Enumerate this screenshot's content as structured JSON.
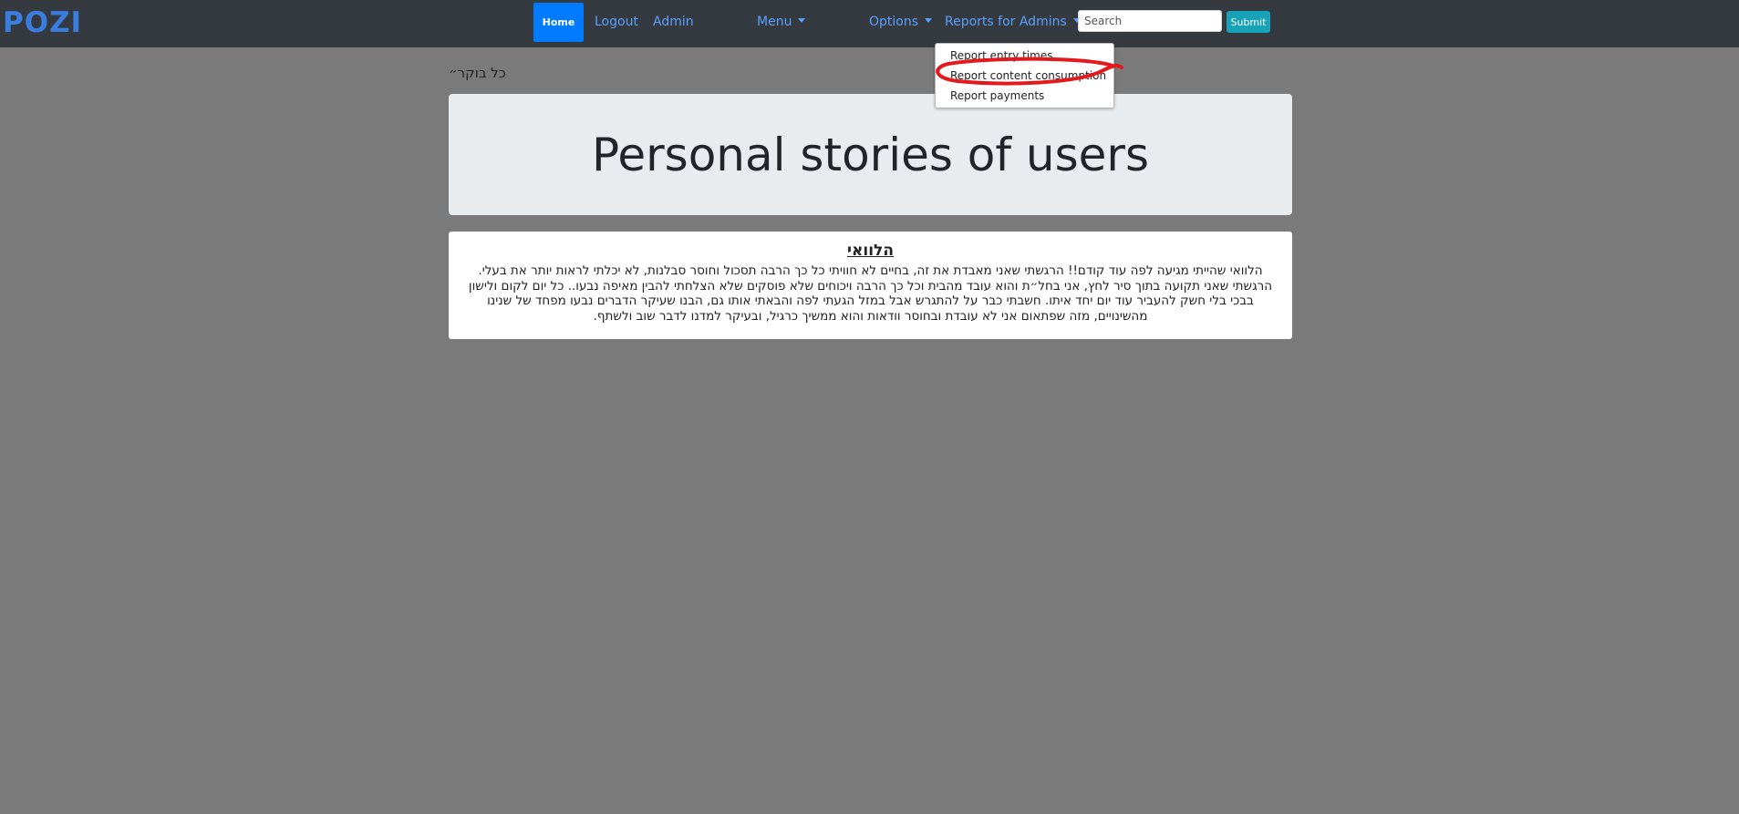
{
  "nav": {
    "brand": "POZI",
    "home": "Home",
    "logout": "Logout",
    "admin": "Admin",
    "menu": "Menu",
    "options": "Options",
    "reports_for_admins": "Reports for Admins",
    "search_placeholder": "Search",
    "submit": "Submit"
  },
  "reports_dropdown": {
    "items": [
      "Report entry times",
      "Report content consumption",
      "Report payments"
    ]
  },
  "quote": "כל בוקר״",
  "jumbotron": {
    "title": "Personal stories of users"
  },
  "story": {
    "title": "הלוואי",
    "text": "הלוואי שהייתי מגיעה לפה עוד קודם!! הרגשתי שאני מאבדת את זה, בחיים לא חוויתי כל כך הרבה תסכול וחוסר סבלנות, לא יכלתי לראות יותר את בעלי. הרגשתי שאני תקועה בתוך סיר לחץ, אני בחל״ת והוא עובד מהבית וכל כך הרבה ויכוחים שלא פוסקים שלא הצלחתי להבין מאיפה נבעו.. כל יום לקום ולישון בבכי בלי חשק להעביר עוד יום יחד איתו. חשבתי כבר על להתגרש אבל במזל הגעתי לפה והבאתי אותו גם, הבנו שעיקר הדברים נבעו מפחד של שנינו מהשינויים, מזה שפתאום אני לא עובדת ובחוסר וודאות והוא ממשיך כרגיל, ובעיקר למדנו לדבר שוב ולשתף."
  },
  "colors": {
    "navbar": "#343a40",
    "link": "#5aa0ff",
    "home_active": "#007bff",
    "submit": "#17a2b8",
    "page_bg": "#7a7a7a",
    "highlight_circle": "#e3191c"
  }
}
